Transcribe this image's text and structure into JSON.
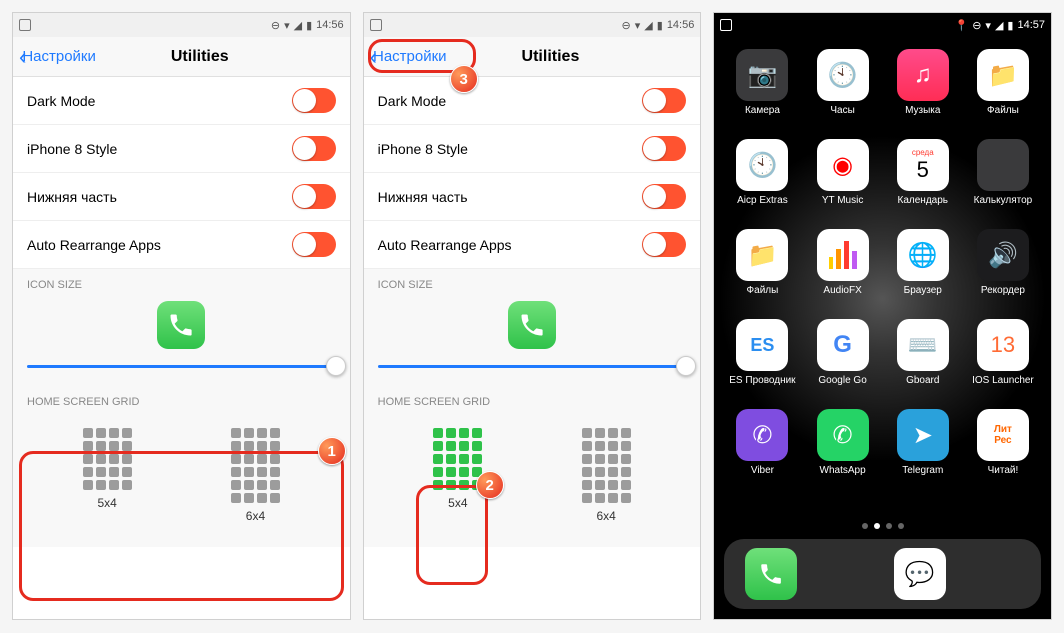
{
  "status": {
    "time1": "14:56",
    "time2": "14:56",
    "time3": "14:57"
  },
  "nav": {
    "back": "Настройки",
    "title": "Utilities"
  },
  "toggles": {
    "darkMode": "Dark Mode",
    "iphone8": "iPhone 8 Style",
    "bottom": "Нижняя часть",
    "autoRearrange": "Auto Rearrange Apps"
  },
  "sections": {
    "iconSize": "ICON SIZE",
    "homeGrid": "HOME SCREEN GRID"
  },
  "grid": {
    "opt1": "5x4",
    "opt2": "6x4"
  },
  "badges": {
    "b1": "1",
    "b2": "2",
    "b3": "3"
  },
  "apps": {
    "r1": [
      "Камера",
      "Часы",
      "Музыка",
      "Файлы"
    ],
    "r2": [
      "Aicp Extras",
      "YT Music",
      "Календарь",
      "Калькулятор"
    ],
    "r3": [
      "Файлы",
      "AudioFX",
      "Браузер",
      "Рекордер"
    ],
    "r4": [
      "ES Проводник",
      "Google Go",
      "Gboard",
      "IOS Launcher"
    ],
    "r5": [
      "Viber",
      "WhatsApp",
      "Telegram",
      "Читай!"
    ]
  },
  "cal": {
    "day": "среда",
    "num": "5"
  }
}
